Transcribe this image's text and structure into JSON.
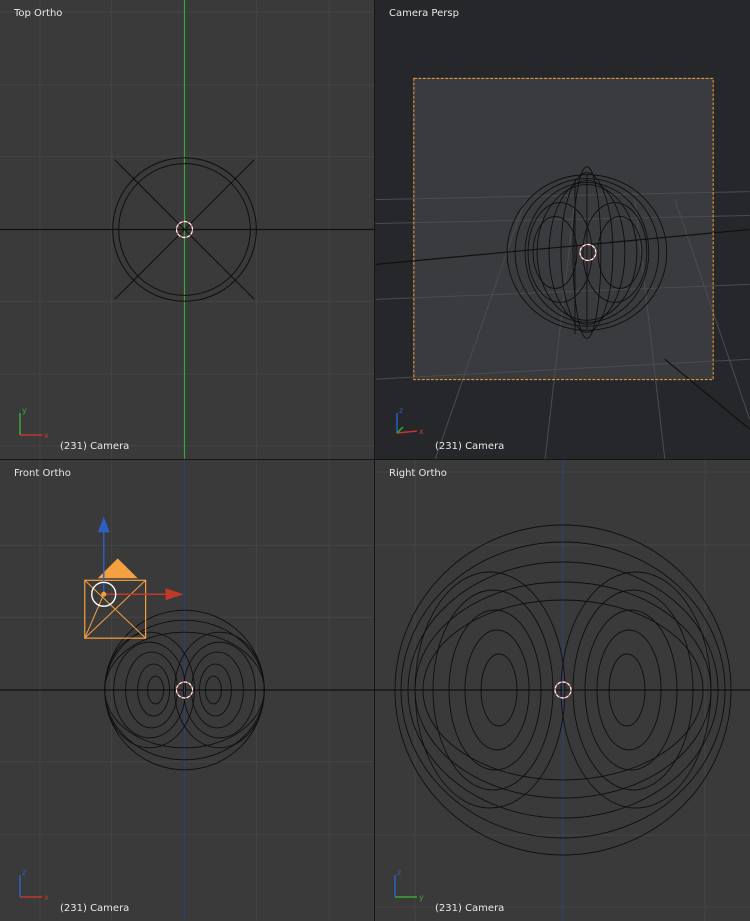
{
  "viewports": {
    "top": {
      "title": "Top Ortho",
      "status": "(231) Camera",
      "axes": {
        "horizontal": "x",
        "vertical": "y"
      }
    },
    "camera": {
      "title": "Camera Persp",
      "status": "(231) Camera",
      "axes": {
        "horizontal": "x",
        "vertical": "z"
      }
    },
    "front": {
      "title": "Front Ortho",
      "status": "(231) Camera",
      "axes": {
        "horizontal": "x",
        "vertical": "z"
      }
    },
    "right": {
      "title": "Right Ortho",
      "status": "(231) Camera",
      "axes": {
        "horizontal": "y",
        "vertical": "z"
      }
    }
  },
  "colors": {
    "viewport_bg": "#3a3a3a",
    "camera_bg": "#26272a",
    "grid_line": "#444444",
    "x_axis": "#c0392b",
    "y_axis": "#3aa63a",
    "z_axis": "#2c5fbf",
    "wire": "#0f0f0f",
    "camera_frame": "#f5a142",
    "cursor": "#ff7a7a"
  },
  "icons": {
    "cursor": "3d-cursor-icon",
    "gizmo": "axis-gizmo-icon",
    "camera": "camera-object-icon",
    "transform": "translate-manipulator-icon"
  }
}
